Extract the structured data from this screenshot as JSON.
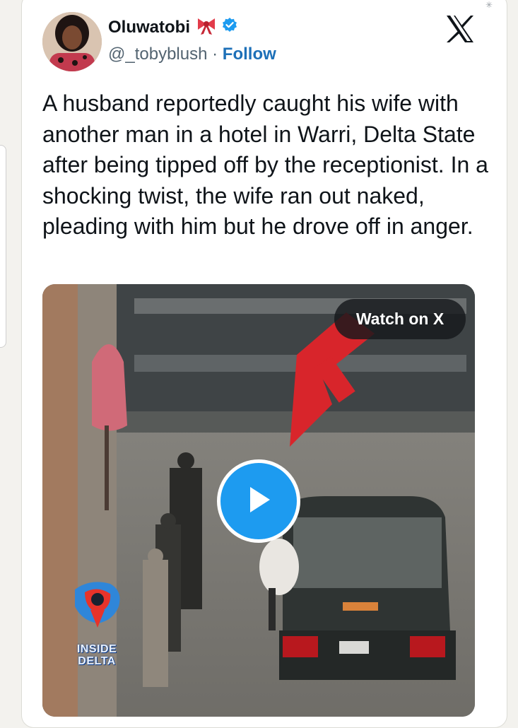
{
  "tweet": {
    "author_name": "Oluwatobi",
    "handle": "@_tobyblush",
    "separator": "·",
    "follow_label": "Follow",
    "text": "A husband reportedly caught his wife with another man in a hotel in Warri, Delta State after being tipped off by the receptionist. In a shocking twist, the wife ran out naked, pleading with him but he drove off in anger."
  },
  "media": {
    "watch_label": "Watch on X",
    "watermark": "INSIDE DELTA"
  },
  "icons": {
    "platform": "x-logo-icon",
    "verified": "verified-badge-icon",
    "emoji": "ribbon-bow-icon",
    "play": "play-icon"
  },
  "colors": {
    "text": "#0f1419",
    "muted": "#536471",
    "follow": "#1d70b8",
    "verified": "#1d9bf0",
    "play": "#1d9bf0"
  }
}
